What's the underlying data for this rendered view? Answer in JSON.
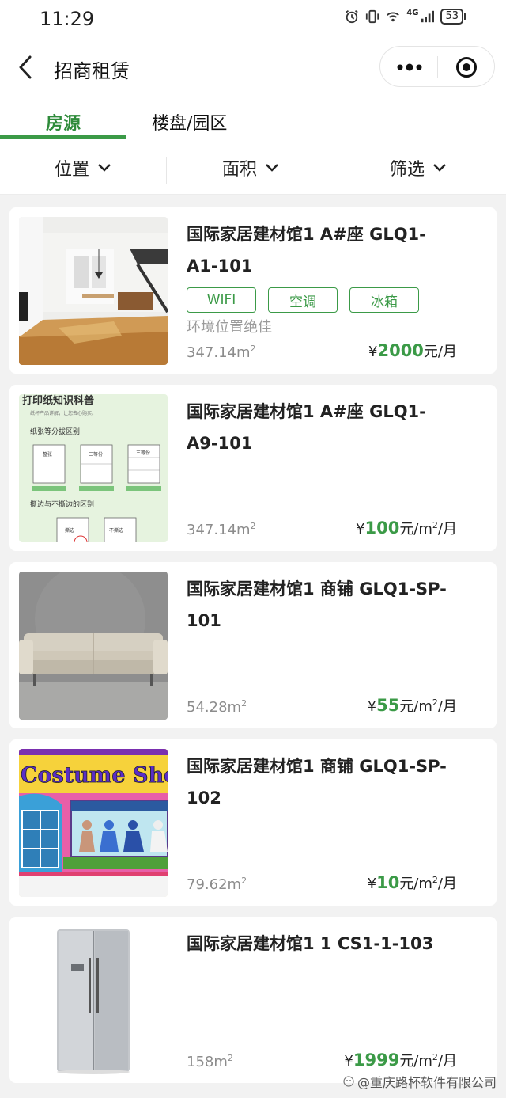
{
  "status": {
    "time": "11:29",
    "network": "4G",
    "battery": "53"
  },
  "nav": {
    "title": "招商租赁"
  },
  "tabs": [
    {
      "label": "房源"
    },
    {
      "label": "楼盘/园区"
    }
  ],
  "filters": [
    {
      "label": "位置"
    },
    {
      "label": "面积"
    },
    {
      "label": "筛选"
    }
  ],
  "listings": [
    {
      "title": "国际家居建材馆1 A#座 GLQ1-A1-101",
      "tags": [
        "WIFI",
        "空调",
        "冰箱"
      ],
      "desc": "环境位置绝佳",
      "area": "347.14m",
      "currency": "¥",
      "price": "2000",
      "unit_pre": "元",
      "unit_sup": "",
      "unit_post": "/月"
    },
    {
      "title": "国际家居建材馆1 A#座 GLQ1-A9-101",
      "area": "347.14m",
      "currency": "¥",
      "price": "100",
      "unit_pre": "元/m",
      "unit_sup": "2",
      "unit_post": "/月",
      "thumb_text": {
        "heading": "打印纸知识科普",
        "sub": "纸杯产品详解，让您去心购买。",
        "section1": "纸张等分拔区别",
        "p1": "整张",
        "p2": "二等份",
        "p3": "三等份",
        "section2": "撕边与不撕边的区别",
        "p4": "撕边",
        "p5": "不撕边"
      }
    },
    {
      "title": "国际家居建材馆1 商铺 GLQ1-SP-101",
      "area": "54.28m",
      "currency": "¥",
      "price": "55",
      "unit_pre": "元/m",
      "unit_sup": "2",
      "unit_post": "/月"
    },
    {
      "title": "国际家居建材馆1 商铺 GLQ1-SP-102",
      "area": "79.62m",
      "currency": "¥",
      "price": "10",
      "unit_pre": "元/m",
      "unit_sup": "2",
      "unit_post": "/月",
      "thumb_text": {
        "sign": "Costume Sho"
      }
    },
    {
      "title": "国际家居建材馆1 1 CS1-1-103",
      "area": "158m",
      "currency": "¥",
      "price": "1999",
      "unit_pre": "元/m",
      "unit_sup": "2",
      "unit_post": "/月"
    }
  ],
  "area_sup": "2",
  "watermark": {
    "text": "@重庆路杯软件有限公司"
  },
  "colors": {
    "accent": "#3b9a47",
    "background": "#f2f2f2"
  }
}
